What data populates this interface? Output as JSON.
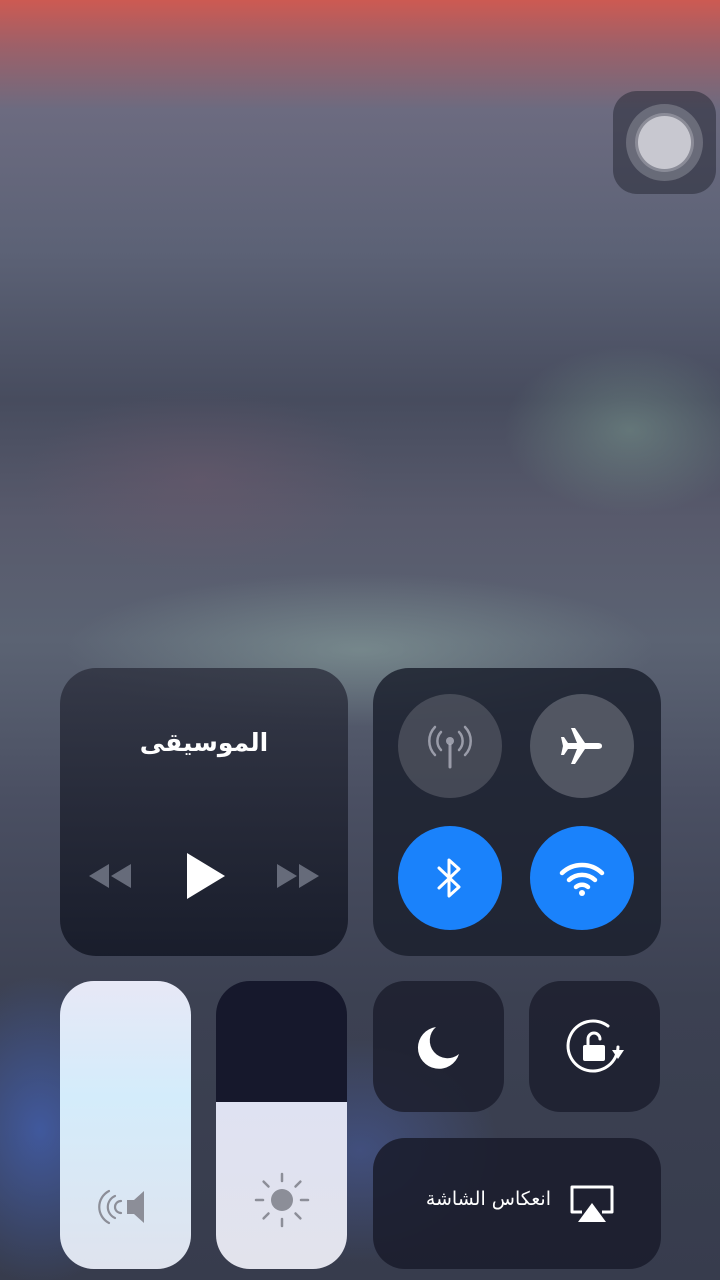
{
  "music": {
    "title": "الموسيقى",
    "controls": [
      "rewind-icon",
      "play-icon",
      "fast-forward-icon"
    ]
  },
  "connectivity": {
    "cellular_data": {
      "icon": "cellular-antenna-icon",
      "state": "off"
    },
    "airplane_mode": {
      "icon": "airplane-icon",
      "state": "off"
    },
    "bluetooth": {
      "icon": "bluetooth-icon",
      "state": "on"
    },
    "wifi": {
      "icon": "wifi-icon",
      "state": "on"
    }
  },
  "volume": {
    "icon": "speaker-icon",
    "level": 1.0
  },
  "brightness": {
    "icon": "sun-icon",
    "level": 0.58
  },
  "do_not_disturb": {
    "icon": "moon-icon"
  },
  "rotation_lock": {
    "icon": "rotation-lock-icon"
  },
  "screen_mirroring": {
    "label": "انعكاس الشاشة",
    "icon": "airplay-icon"
  },
  "assistive_touch": {
    "icon": "assistive-touch-icon"
  },
  "colors": {
    "active_blue": "#1a82fb",
    "tile_dark": "#1c1f2e",
    "slider_light": "#e2e3ec"
  }
}
